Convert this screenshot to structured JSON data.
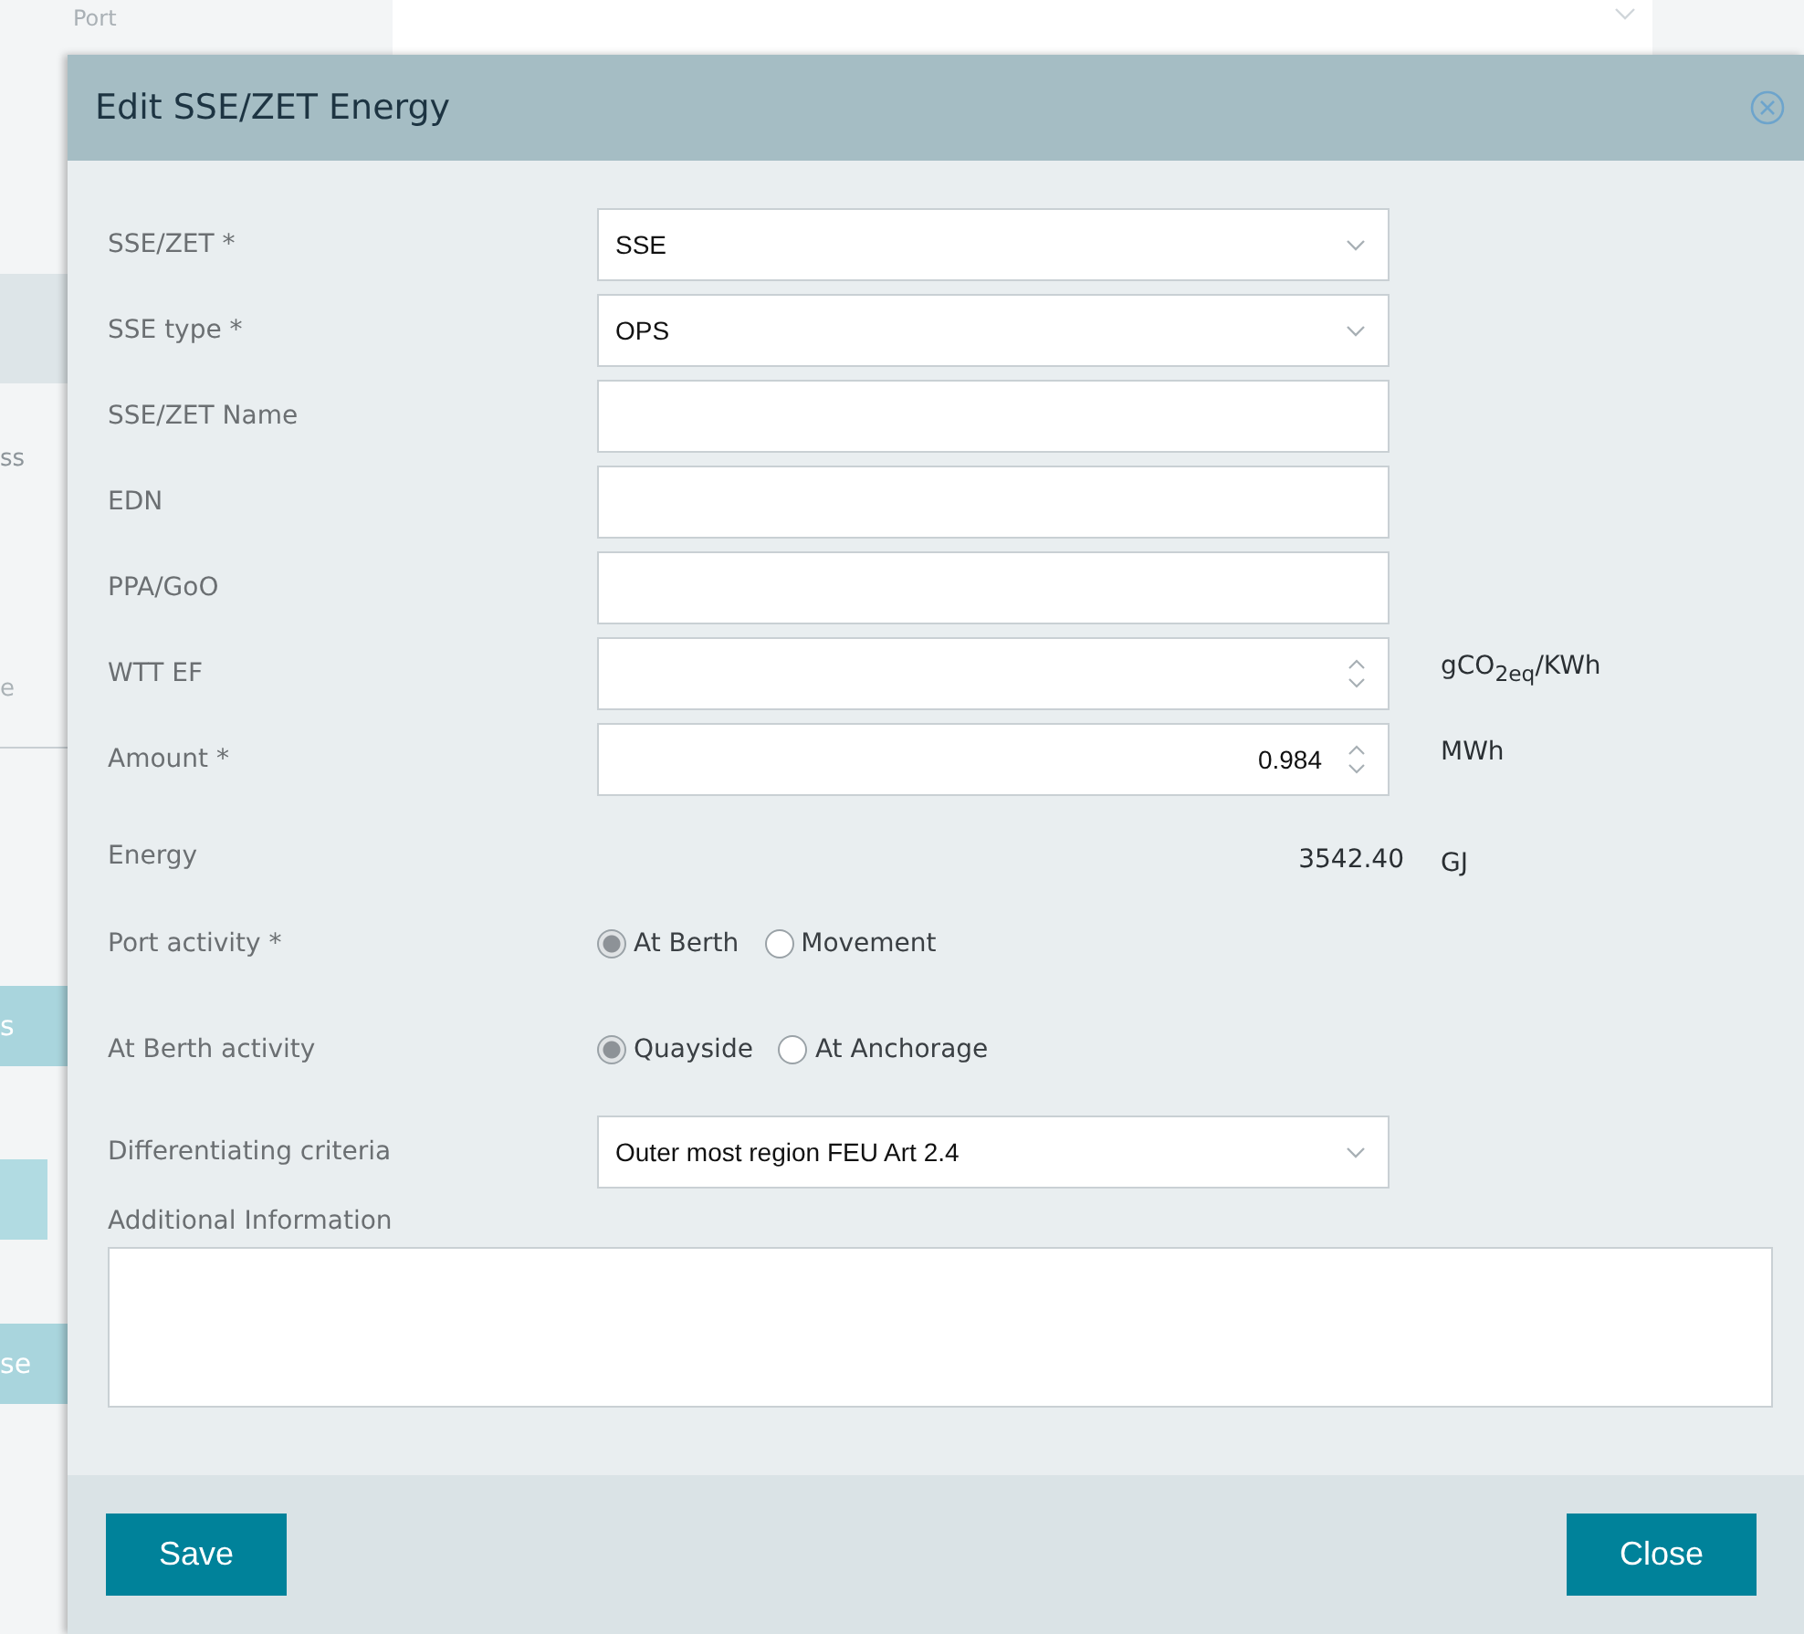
{
  "background": {
    "port_label": "Port",
    "fragments": [
      {
        "kind": "panel"
      },
      {
        "kind": "text",
        "text": "ss"
      },
      {
        "kind": "field",
        "text": "e"
      },
      {
        "kind": "button",
        "text": "s"
      },
      {
        "kind": "block"
      },
      {
        "kind": "button",
        "text": "se"
      }
    ]
  },
  "dialog": {
    "title": "Edit SSE/ZET Energy",
    "fields": [
      {
        "label": "SSE/ZET *",
        "kind": "select",
        "value": "SSE"
      },
      {
        "label": "SSE type *",
        "kind": "select",
        "value": "OPS"
      },
      {
        "label": "SSE/ZET Name",
        "kind": "text"
      },
      {
        "label": "EDN",
        "kind": "text"
      },
      {
        "label": "PPA/GoO",
        "kind": "text"
      },
      {
        "label": "WTT EF",
        "kind": "number",
        "unit": "gCO$_{2eq}$/KWh"
      },
      {
        "label": "Amount *",
        "kind": "number",
        "value": "0.984",
        "unit": "MWh"
      },
      {
        "label": "Energy",
        "kind": "readout",
        "value": "3542.40",
        "unit": "GJ"
      }
    ],
    "radio_groups": [
      {
        "label": "Port activity *",
        "options": [
          {
            "label": "At Berth",
            "selected": true
          },
          {
            "label": "Movement",
            "selected": false
          }
        ]
      },
      {
        "label": "At Berth activity",
        "options": [
          {
            "label": "Quayside",
            "selected": true
          },
          {
            "label": "At Anchorage",
            "selected": false
          }
        ]
      }
    ],
    "criteria": {
      "label": "Differentiating criteria",
      "value": "Outer most region FEU Art 2.4"
    },
    "additional_info": {
      "label": "Additional Information"
    },
    "buttons": [
      {
        "label": "Save"
      },
      {
        "label": "Close"
      }
    ]
  }
}
